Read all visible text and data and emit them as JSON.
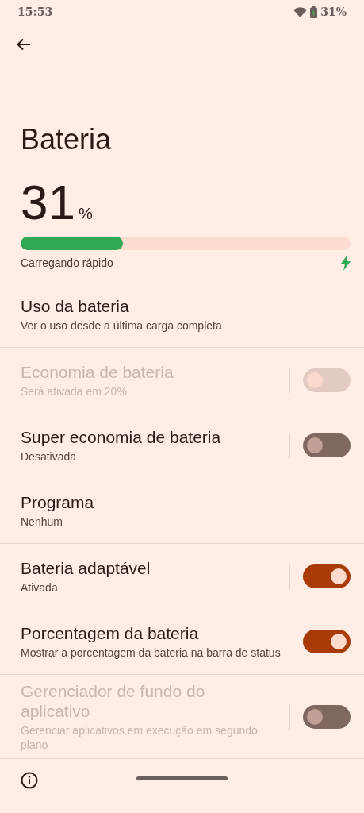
{
  "status_bar": {
    "time": "15:53",
    "battery": "31%"
  },
  "title": "Bateria",
  "battery": {
    "percent": "31",
    "unit": "%",
    "level": 0.31,
    "status": "Carregando rápido"
  },
  "sections": [
    [
      {
        "kind": "link",
        "title": "Uso da bateria",
        "subtitle": "Ver o uso desde a última carga completa",
        "disabled": false
      }
    ],
    [
      {
        "kind": "split_toggle",
        "title": "Economia de bateria",
        "subtitle": "Será ativada em 20%",
        "disabled": true,
        "toggle_disabled": true,
        "on": false
      },
      {
        "kind": "split_toggle",
        "title": "Super economia de bateria",
        "subtitle": "Desativada",
        "disabled": false,
        "toggle_disabled": false,
        "on": false
      },
      {
        "kind": "link",
        "title": "Programa",
        "subtitle": "Nenhum",
        "disabled": false
      }
    ],
    [
      {
        "kind": "split_toggle",
        "title": "Bateria adaptável",
        "subtitle": "Ativada",
        "disabled": false,
        "toggle_disabled": false,
        "on": true
      },
      {
        "kind": "toggle",
        "title": "Porcentagem da bateria",
        "subtitle": "Mostrar a porcentagem da bateria na barra de status",
        "disabled": false,
        "toggle_disabled": false,
        "on": true
      }
    ],
    [
      {
        "kind": "split_toggle",
        "title": "Gerenciador de fundo do aplicativo",
        "subtitle": "Gerenciar aplicativos em execução em segundo plano",
        "disabled": true,
        "toggle_disabled": false,
        "on": false
      }
    ]
  ]
}
